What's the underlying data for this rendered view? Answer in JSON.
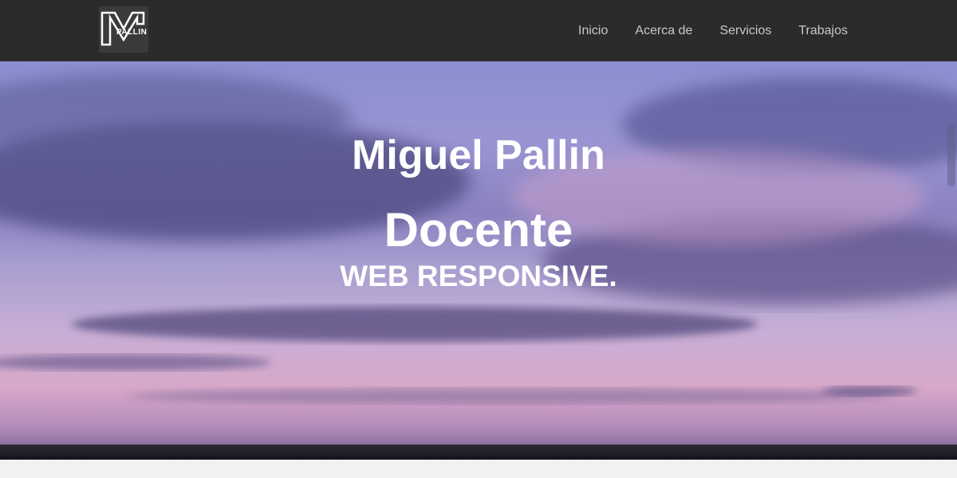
{
  "brand": {
    "logo_text": "PALLIN",
    "logo_letter": "M"
  },
  "nav": {
    "items": [
      {
        "label": "Inicio"
      },
      {
        "label": "Acerca de"
      },
      {
        "label": "Servicios"
      },
      {
        "label": "Trabajos"
      }
    ]
  },
  "hero": {
    "name": "Miguel Pallin",
    "role": "Docente",
    "tagline": "WEB RESPONSIVE."
  },
  "colors": {
    "navbar": "#2b2b2b",
    "nav_text": "#c9c9c9",
    "hero_text": "#ffffff",
    "page_background": "#f1f1f1"
  }
}
